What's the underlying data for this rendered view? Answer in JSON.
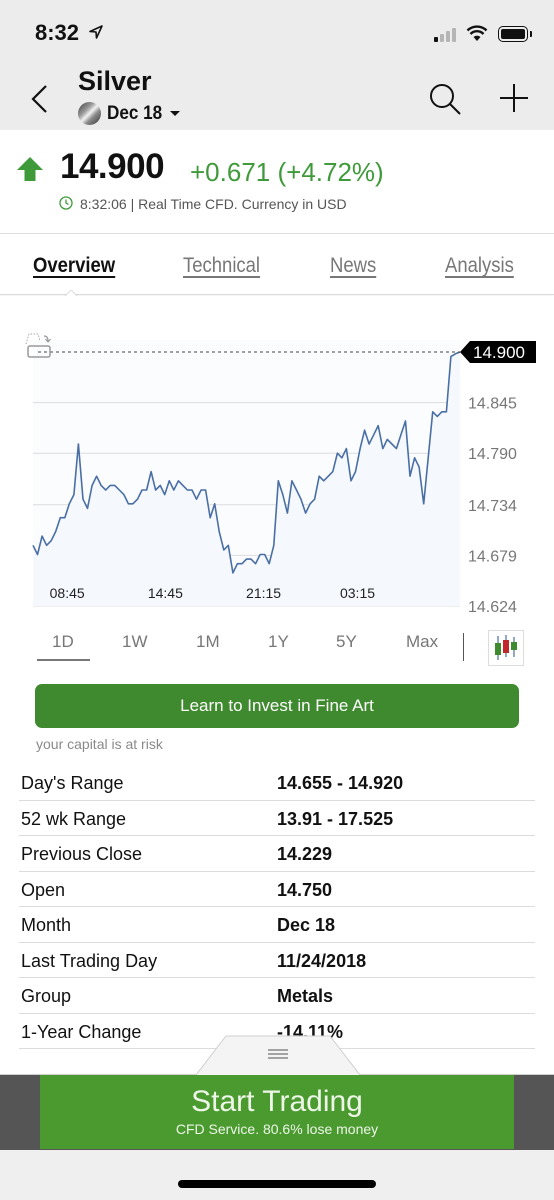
{
  "status_bar": {
    "time": "8:32",
    "signal_bars_on": 1,
    "signal_bars_total": 4,
    "battery_level": 1.0
  },
  "header": {
    "title": "Silver",
    "contract": "Dec 18"
  },
  "quote": {
    "price": "14.900",
    "change": "+0.671 (+4.72%)",
    "meta": "8:32:06 | Real Time CFD. Currency in USD",
    "direction": "up",
    "up_color": "#3f9a3a"
  },
  "tabs": [
    {
      "label": "Overview",
      "active": true
    },
    {
      "label": "Technical",
      "active": false
    },
    {
      "label": "News",
      "active": false
    },
    {
      "label": "Analysis",
      "active": false
    }
  ],
  "chart_data": {
    "type": "area",
    "title": "",
    "xlabel": "",
    "ylabel": "",
    "x_tick_labels": [
      "08:45",
      "14:45",
      "21:15",
      "03:15"
    ],
    "x_tick_positions": [
      8,
      31,
      54,
      76
    ],
    "y_tick_labels": [
      "14.845",
      "14.790",
      "14.734",
      "14.679",
      "14.624"
    ],
    "y_ticks": [
      14.845,
      14.79,
      14.734,
      14.679,
      14.624
    ],
    "ylim": [
      14.624,
      14.9
    ],
    "grid": true,
    "last_value_label": "14.900",
    "last_value": 14.9,
    "line_color": "#4a6fa5",
    "values": [
      14.69,
      14.68,
      14.7,
      14.69,
      14.695,
      14.705,
      14.72,
      14.72,
      14.735,
      14.745,
      14.8,
      14.74,
      14.73,
      14.755,
      14.765,
      14.755,
      14.75,
      14.755,
      14.755,
      14.75,
      14.745,
      14.735,
      14.735,
      14.74,
      14.75,
      14.75,
      14.77,
      14.75,
      14.755,
      14.745,
      14.76,
      14.75,
      14.76,
      14.755,
      14.75,
      14.75,
      14.74,
      14.75,
      14.75,
      14.72,
      14.735,
      14.705,
      14.685,
      14.69,
      14.66,
      14.67,
      14.67,
      14.675,
      14.675,
      14.67,
      14.68,
      14.68,
      14.67,
      14.69,
      14.76,
      14.745,
      14.725,
      14.76,
      14.75,
      14.74,
      14.725,
      14.735,
      14.74,
      14.765,
      14.76,
      14.765,
      14.77,
      14.79,
      14.785,
      14.795,
      14.76,
      14.77,
      14.795,
      14.815,
      14.8,
      14.81,
      14.82,
      14.795,
      14.805,
      14.8,
      14.795,
      14.81,
      14.825,
      14.765,
      14.785,
      14.775,
      14.735,
      14.785,
      14.835,
      14.83,
      14.835,
      14.835,
      14.895,
      14.898,
      14.9
    ]
  },
  "ranges": {
    "items": [
      "1D",
      "1W",
      "1M",
      "1Y",
      "5Y",
      "Max"
    ],
    "selected": "1D"
  },
  "promo": {
    "button_label": "Learn to Invest in Fine Art",
    "note": "your capital is at risk"
  },
  "stats": [
    {
      "label": "Day's Range",
      "value": "14.655 - 14.920"
    },
    {
      "label": "52 wk Range",
      "value": "13.91 - 17.525"
    },
    {
      "label": "Previous Close",
      "value": "14.229"
    },
    {
      "label": "Open",
      "value": "14.750"
    },
    {
      "label": "Month",
      "value": "Dec 18"
    },
    {
      "label": "Last Trading Day",
      "value": "11/24/2018"
    },
    {
      "label": "Group",
      "value": "Metals"
    },
    {
      "label": "1-Year Change",
      "value": "-14.11%"
    }
  ],
  "cta": {
    "title": "Start Trading",
    "subtitle": "CFD Service. 80.6% lose money",
    "color": "#4a9a30"
  }
}
